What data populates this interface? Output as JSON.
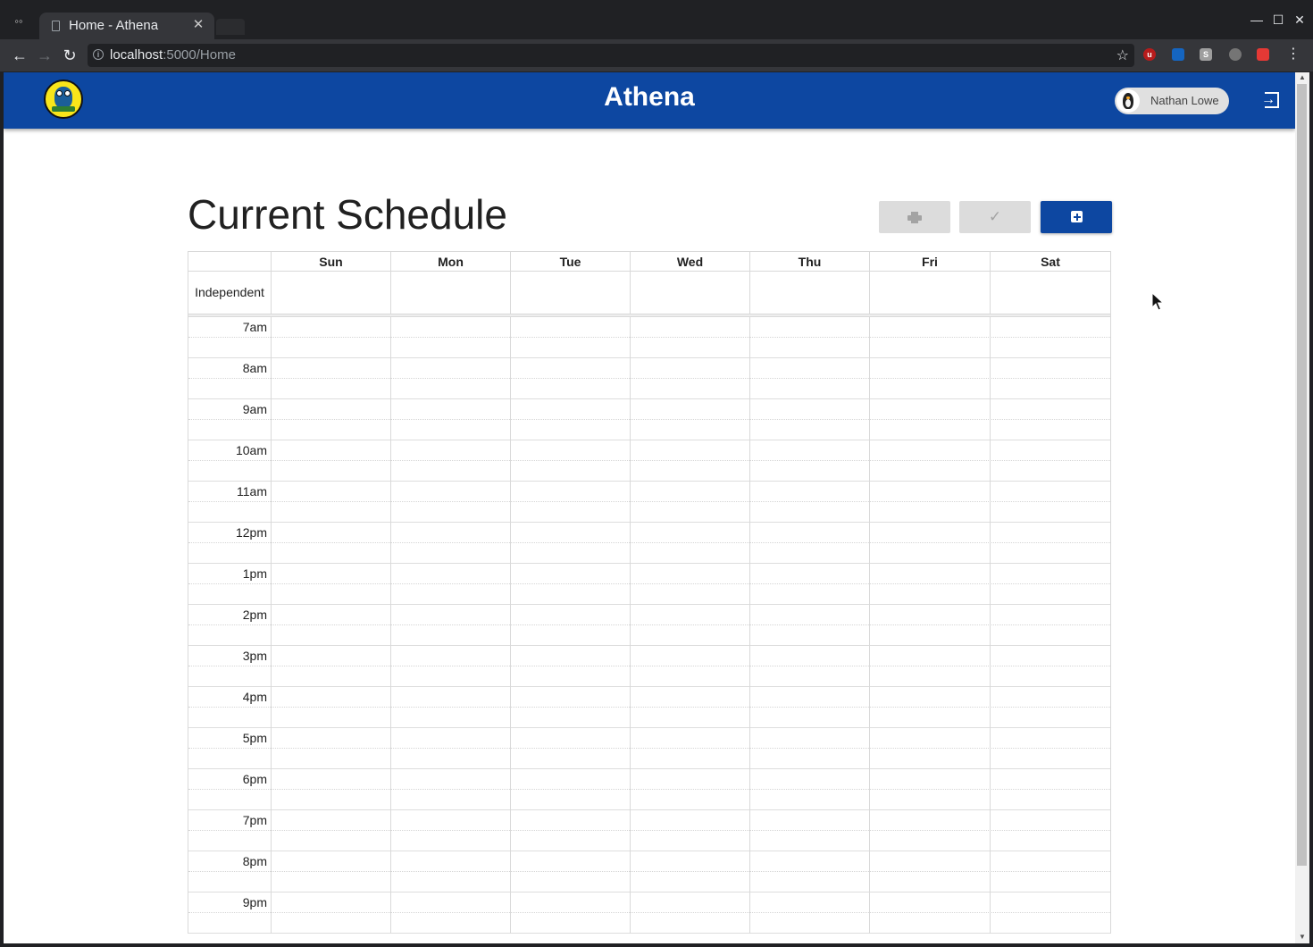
{
  "browser": {
    "tab_title": "Home - Athena",
    "url_host": "localhost",
    "url_rest": ":5000/Home"
  },
  "app": {
    "title": "Athena",
    "user_name": "Nathan Lowe",
    "brand_color": "#0d47a1"
  },
  "page": {
    "title": "Current Schedule",
    "actions": [
      {
        "name": "print",
        "icon": "print-icon",
        "enabled": false
      },
      {
        "name": "validate",
        "icon": "check-icon",
        "enabled": false
      },
      {
        "name": "add",
        "icon": "plus-square-icon",
        "enabled": true
      }
    ]
  },
  "calendar": {
    "days": [
      "Sun",
      "Mon",
      "Tue",
      "Wed",
      "Thu",
      "Fri",
      "Sat"
    ],
    "allday_label": "Independent",
    "hours": [
      "7am",
      "8am",
      "9am",
      "10am",
      "11am",
      "12pm",
      "1pm",
      "2pm",
      "3pm",
      "4pm",
      "5pm",
      "6pm",
      "7pm",
      "8pm",
      "9pm"
    ]
  }
}
